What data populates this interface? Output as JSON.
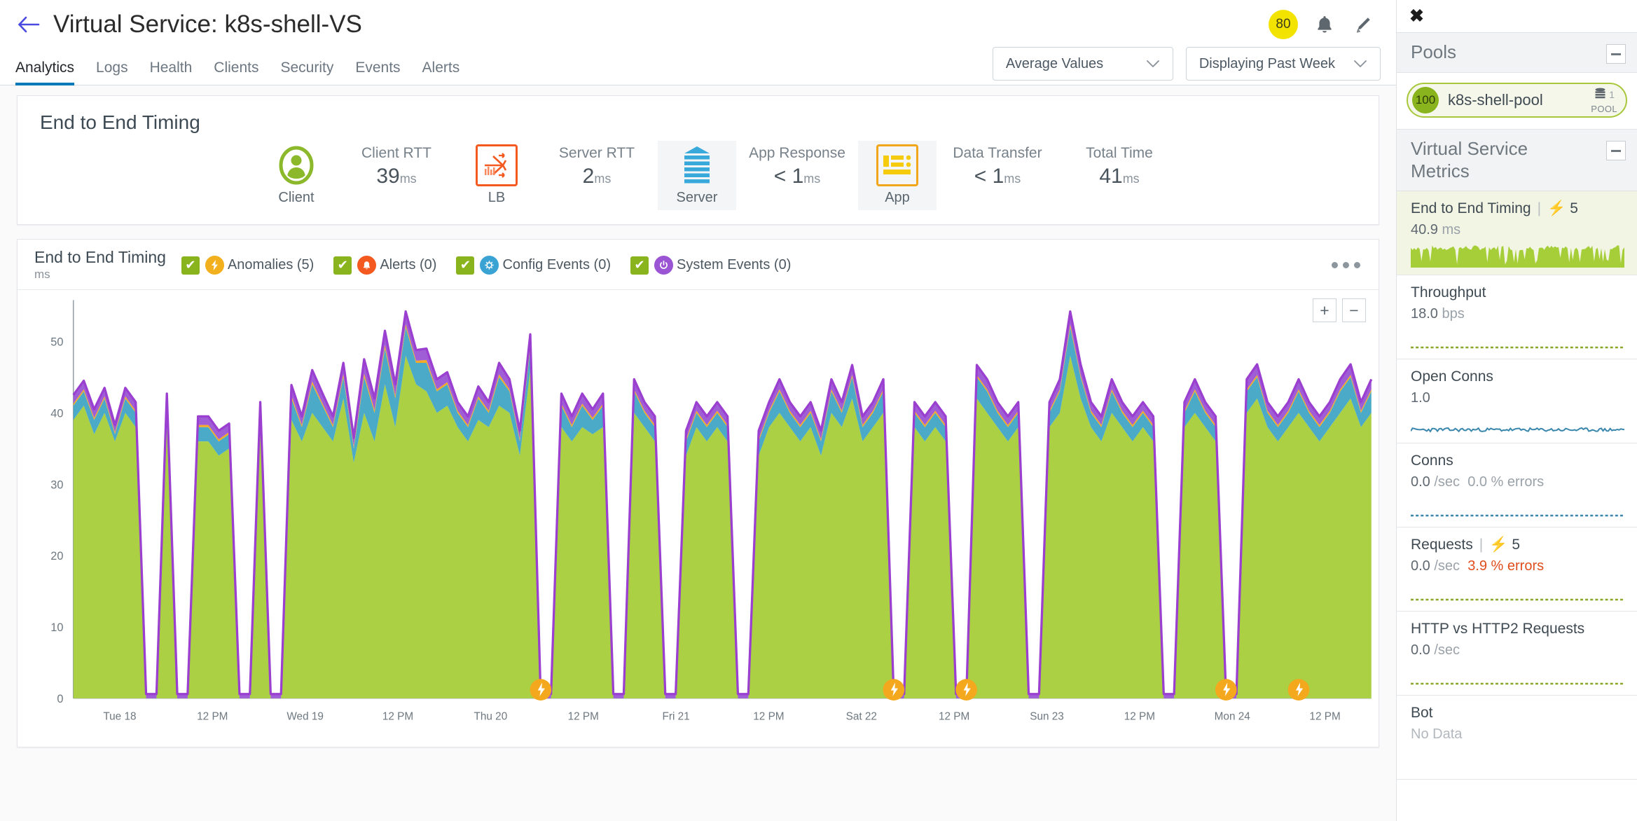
{
  "header": {
    "back_icon": "arrow-left-icon",
    "title": "Virtual Service:  k8s-shell-VS",
    "health_score": "80",
    "bell_icon": "bell-icon",
    "edit_icon": "pencil-icon"
  },
  "tabs": [
    {
      "label": "Analytics",
      "active": true
    },
    {
      "label": "Logs",
      "active": false
    },
    {
      "label": "Health",
      "active": false
    },
    {
      "label": "Clients",
      "active": false
    },
    {
      "label": "Security",
      "active": false
    },
    {
      "label": "Events",
      "active": false
    },
    {
      "label": "Alerts",
      "active": false
    }
  ],
  "controls": {
    "values_select": "Average Values",
    "range_select": "Displaying Past Week",
    "chevron_icon": "chevron-down-icon"
  },
  "e2e": {
    "title": "End to End Timing",
    "nodes": [
      {
        "name": "Client",
        "icon": "client-person-icon",
        "highlight": false
      },
      {
        "name": "LB",
        "icon": "load-balancer-icon",
        "highlight": false
      },
      {
        "name": "Server",
        "icon": "server-stack-icon",
        "highlight": true
      },
      {
        "name": "App",
        "icon": "app-list-icon",
        "highlight": true
      }
    ],
    "metrics": [
      {
        "label": "Client RTT",
        "value": "39",
        "unit": "ms"
      },
      {
        "label": "Server RTT",
        "value": "2",
        "unit": "ms"
      },
      {
        "label": "App Response",
        "value": "< 1",
        "unit": "ms"
      },
      {
        "label": "Data Transfer",
        "value": "< 1",
        "unit": "ms"
      },
      {
        "label": "Total Time",
        "value": "41",
        "unit": "ms"
      }
    ]
  },
  "chart_panel": {
    "title": "End to End Timing",
    "units": "ms",
    "legend": [
      {
        "label": "Anomalies (5)",
        "checked": true,
        "icon": "anomaly-bolt-icon",
        "color": "#f2b01e"
      },
      {
        "label": "Alerts (0)",
        "checked": true,
        "icon": "alert-bell-icon",
        "color": "#f4591f"
      },
      {
        "label": "Config Events (0)",
        "checked": true,
        "icon": "config-gear-icon",
        "color": "#3aa3d4"
      },
      {
        "label": "System Events (0)",
        "checked": true,
        "icon": "system-power-icon",
        "color": "#9a54d4"
      }
    ],
    "more_icon": "more-options-icon",
    "zoom_in": "+",
    "zoom_out": "−"
  },
  "chart_data": {
    "type": "area",
    "title": "End to End Timing",
    "xlabel": "",
    "ylabel": "ms",
    "ylim": [
      0,
      55
    ],
    "yticks": [
      0,
      10,
      20,
      30,
      40,
      50
    ],
    "grid": false,
    "legend_position": "top",
    "xtick_labels": [
      "Tue 18",
      "12 PM",
      "Wed 19",
      "12 PM",
      "Thu 20",
      "12 PM",
      "Fri 21",
      "12 PM",
      "Sat 22",
      "12 PM",
      "Sun 23",
      "12 PM",
      "Mon 24",
      "12 PM"
    ],
    "series": [
      {
        "name": "Client RTT",
        "color": "#a6ce39",
        "values": [
          39,
          41,
          37,
          40,
          36,
          40,
          38,
          0,
          0,
          38,
          0,
          0,
          36,
          36,
          34,
          35,
          0,
          0,
          38,
          0,
          0,
          39,
          36,
          40,
          38,
          36,
          42,
          33,
          40,
          36,
          44,
          38,
          48,
          44,
          43,
          40,
          41,
          38,
          36,
          39,
          38,
          41,
          40,
          34,
          46,
          0,
          0,
          38,
          36,
          38,
          37,
          38,
          0,
          0,
          40,
          38,
          36,
          0,
          0,
          34,
          38,
          36,
          38,
          36,
          0,
          0,
          34,
          38,
          40,
          38,
          36,
          38,
          34,
          40,
          38,
          42,
          36,
          38,
          40,
          0,
          0,
          38,
          36,
          38,
          36,
          0,
          0,
          42,
          40,
          38,
          36,
          38,
          0,
          0,
          38,
          40,
          48,
          42,
          38,
          36,
          40,
          38,
          36,
          38,
          36,
          0,
          0,
          38,
          40,
          38,
          36,
          0,
          0,
          40,
          42,
          38,
          36,
          38,
          40,
          38,
          36,
          38,
          40,
          42,
          38,
          40
        ]
      },
      {
        "name": "Server RTT",
        "color": "#42a5c6",
        "values": [
          2,
          2,
          2,
          2,
          1,
          2,
          2,
          0,
          0,
          3,
          0,
          0,
          2,
          2,
          2,
          2,
          0,
          0,
          2,
          0,
          0,
          3,
          2,
          4,
          3,
          2,
          3,
          2,
          5,
          4,
          5,
          4,
          4,
          3,
          4,
          3,
          3,
          2,
          2,
          3,
          2,
          4,
          3,
          2,
          3,
          0,
          0,
          3,
          2,
          3,
          2,
          3,
          0,
          0,
          3,
          2,
          2,
          0,
          0,
          2,
          2,
          2,
          2,
          2,
          0,
          0,
          2,
          2,
          3,
          2,
          2,
          2,
          2,
          3,
          2,
          3,
          2,
          2,
          3,
          0,
          0,
          2,
          2,
          2,
          2,
          0,
          0,
          3,
          3,
          2,
          2,
          2,
          0,
          0,
          2,
          3,
          4,
          3,
          2,
          2,
          3,
          2,
          2,
          2,
          2,
          0,
          0,
          2,
          3,
          2,
          2,
          0,
          0,
          3,
          3,
          2,
          2,
          2,
          3,
          2,
          2,
          2,
          3,
          3,
          2,
          3
        ]
      },
      {
        "name": "App Response",
        "color": "#f2a71b",
        "values": [
          0.3,
          0.3,
          0.3,
          0.3,
          0.3,
          0.3,
          0.3,
          0,
          0,
          0.3,
          0,
          0,
          0.3,
          0.3,
          0.3,
          0.3,
          0,
          0,
          0.3,
          0,
          0,
          0.4,
          0.3,
          0.4,
          0.3,
          0.3,
          0.4,
          0.3,
          0.5,
          0.4,
          0.5,
          0.4,
          0.4,
          0.3,
          0.4,
          0.3,
          0.3,
          0.3,
          0.3,
          0.3,
          0.3,
          0.4,
          0.3,
          0.3,
          0.4,
          0,
          0,
          0.3,
          0.3,
          0.3,
          0.3,
          0.3,
          0,
          0,
          0.3,
          0.3,
          0.3,
          0,
          0,
          0.3,
          0.3,
          0.3,
          0.3,
          0.3,
          0,
          0,
          0.3,
          0.3,
          0.3,
          0.3,
          0.3,
          0.3,
          0.3,
          0.3,
          0.3,
          0.3,
          0.3,
          0.3,
          0.3,
          0,
          0,
          0.3,
          0.3,
          0.3,
          0.3,
          0,
          0,
          0.3,
          0.3,
          0.3,
          0.3,
          0.3,
          0,
          0,
          0.3,
          0.3,
          0.4,
          0.3,
          0.3,
          0.3,
          0.3,
          0.3,
          0.3,
          0.3,
          0.3,
          0,
          0,
          0.3,
          0.3,
          0.3,
          0.3,
          0,
          0,
          0.3,
          0.3,
          0.3,
          0.3,
          0.3,
          0.3,
          0.3,
          0.3,
          0.3,
          0.3,
          0.3,
          0.3,
          0.3
        ]
      },
      {
        "name": "Data Transfer",
        "color": "#9a54d4",
        "values": [
          1.2,
          1.2,
          1.2,
          1.2,
          1.0,
          1.2,
          1.2,
          0.6,
          0.6,
          1.4,
          0.6,
          0.6,
          1.2,
          1.2,
          1.2,
          1.2,
          0.6,
          0.6,
          1.2,
          0.6,
          0.6,
          1.5,
          1.2,
          1.6,
          1.4,
          1.2,
          1.6,
          1.2,
          2.0,
          1.6,
          2.0,
          1.6,
          1.8,
          1.5,
          1.6,
          1.4,
          1.4,
          1.2,
          1.2,
          1.4,
          1.2,
          1.6,
          1.4,
          1.2,
          1.6,
          0.6,
          0.6,
          1.4,
          1.2,
          1.4,
          1.2,
          1.4,
          0.6,
          0.6,
          1.4,
          1.2,
          1.2,
          0.6,
          0.6,
          1.2,
          1.2,
          1.2,
          1.2,
          1.2,
          0.6,
          0.6,
          1.2,
          1.2,
          1.4,
          1.2,
          1.2,
          1.2,
          1.2,
          1.4,
          1.2,
          1.4,
          1.2,
          1.2,
          1.4,
          0.6,
          0.6,
          1.2,
          1.2,
          1.2,
          1.2,
          0.6,
          0.6,
          1.4,
          1.4,
          1.2,
          1.2,
          1.2,
          0.6,
          0.6,
          1.2,
          1.4,
          1.8,
          1.5,
          1.2,
          1.2,
          1.4,
          1.2,
          1.2,
          1.2,
          1.2,
          0.6,
          0.6,
          1.2,
          1.4,
          1.2,
          1.2,
          0.6,
          0.6,
          1.4,
          1.5,
          1.2,
          1.2,
          1.2,
          1.4,
          1.2,
          1.2,
          1.2,
          1.4,
          1.5,
          1.2,
          1.4
        ]
      }
    ],
    "anomaly_markers": [
      {
        "x_index": 45,
        "label": "anomaly"
      },
      {
        "x_index": 79,
        "label": "anomaly"
      },
      {
        "x_index": 111,
        "label": "anomaly"
      },
      {
        "x_index": 86,
        "label": "anomaly"
      },
      {
        "x_index": 118,
        "label": "anomaly"
      }
    ]
  },
  "right_panel": {
    "close_icon": "close-icon",
    "pools_section": {
      "title": "Pools",
      "collapse_icon": "collapse-icon",
      "pool": {
        "score": "100",
        "name": "k8s-shell-pool",
        "count": "1",
        "type_label": "POOL",
        "server_icon": "pool-server-icon"
      }
    },
    "metrics_section": {
      "title": "Virtual Service Metrics",
      "collapse_icon": "collapse-icon",
      "items": [
        {
          "name": "End to End Timing",
          "anomaly_count": "5",
          "has_anomaly": true,
          "value": "40.9",
          "value_dim": " ms",
          "errors": "",
          "selected": true,
          "spark_type": "area",
          "spark_color": "#a6ce39"
        },
        {
          "name": "Throughput",
          "anomaly_count": "",
          "has_anomaly": false,
          "value": "18.0",
          "value_dim": " bps",
          "errors": "",
          "selected": false,
          "spark_type": "flat",
          "spark_color": "#8ba82b"
        },
        {
          "name": "Open Conns",
          "anomaly_count": "",
          "has_anomaly": false,
          "value": "1.0",
          "value_dim": "",
          "errors": "",
          "selected": false,
          "spark_type": "noisy",
          "spark_color": "#3a87ad"
        },
        {
          "name": "Conns",
          "anomaly_count": "",
          "has_anomaly": false,
          "value": "0.0",
          "value_dim": " /sec",
          "errors": "0.0 % errors",
          "errors_highlight": false,
          "selected": false,
          "spark_type": "flat",
          "spark_color": "#3a87ad"
        },
        {
          "name": "Requests",
          "anomaly_count": "5",
          "has_anomaly": true,
          "value": "0.0",
          "value_dim": " /sec",
          "errors": "3.9 % errors",
          "errors_highlight": true,
          "selected": false,
          "spark_type": "flat",
          "spark_color": "#8ba82b"
        },
        {
          "name": "HTTP vs HTTP2 Requests",
          "anomaly_count": "",
          "has_anomaly": false,
          "value": "0.0",
          "value_dim": " /sec",
          "errors": "",
          "selected": false,
          "spark_type": "flat",
          "spark_color": "#8ba82b"
        },
        {
          "name": "Bot",
          "anomaly_count": "",
          "has_anomaly": false,
          "value": "No Data",
          "value_dim": "",
          "errors": "",
          "no_data": true,
          "selected": false,
          "spark_type": "none",
          "spark_color": "#cccccc"
        }
      ]
    }
  }
}
